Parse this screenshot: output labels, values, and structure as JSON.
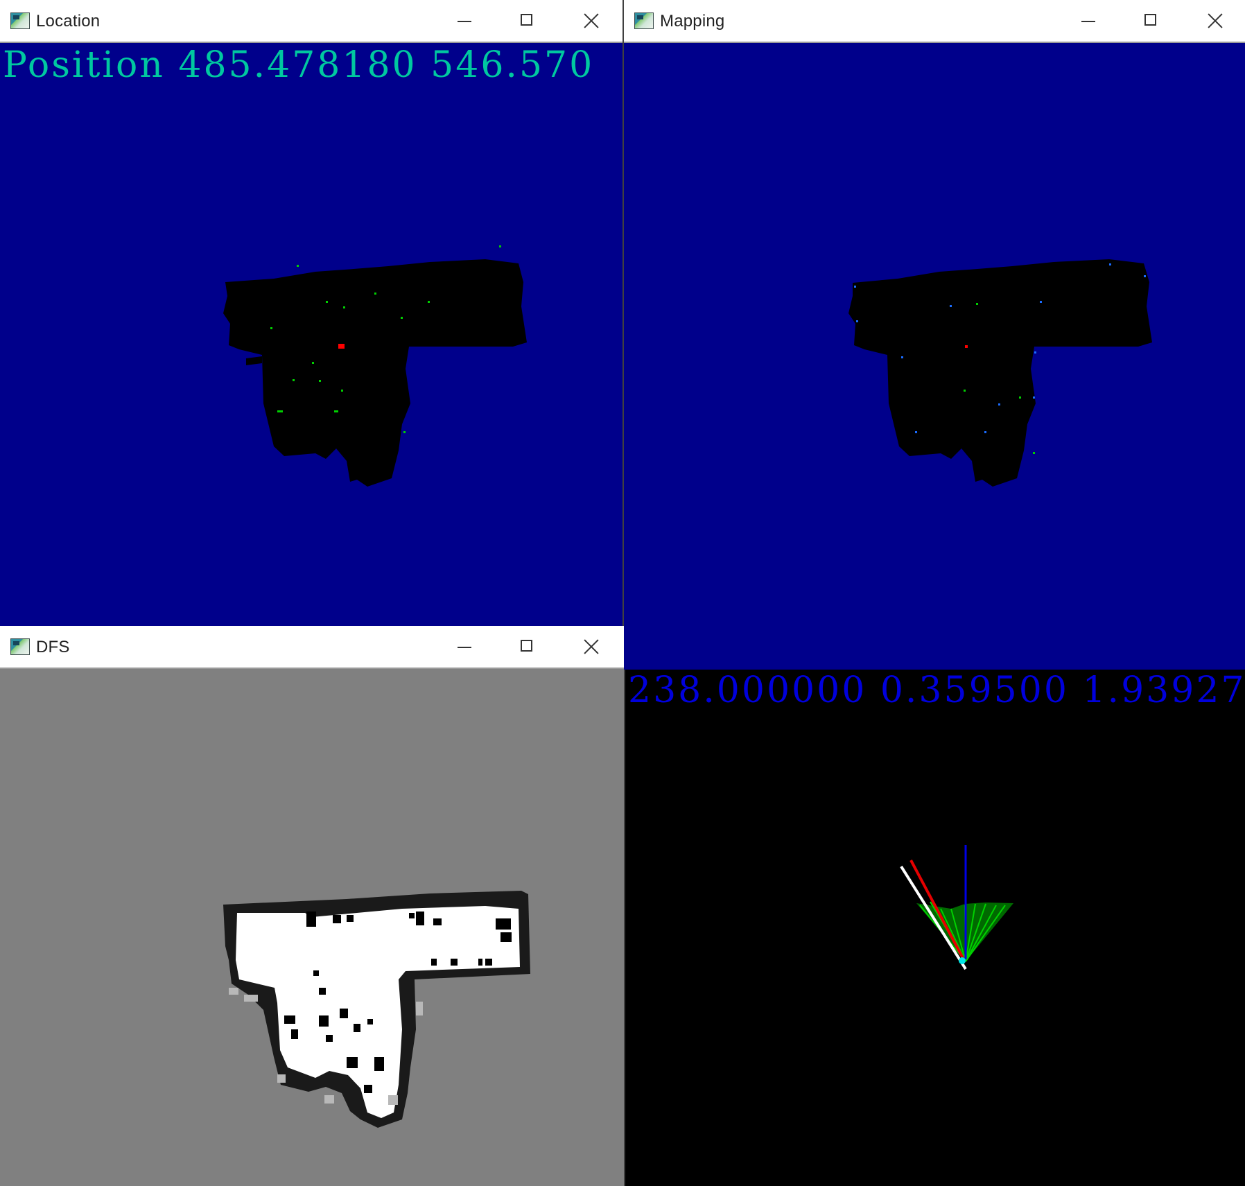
{
  "windows": {
    "location": {
      "title": "Location",
      "overlay_text": "Position 485.478180  546.570",
      "bg_color": "#00008b",
      "text_color": "#00c8a0"
    },
    "mapping": {
      "title": "Mapping",
      "bg_color": "#00008b"
    },
    "dfs": {
      "title": "DFS",
      "bg_color": "#808080"
    },
    "scan": {
      "overlay_text": "238.000000  0.359500  1.93927",
      "bg_color": "#000000",
      "text_color": "#0000dc"
    }
  },
  "colors": {
    "robot_marker": "#ff0000",
    "scan_points": "#00e600",
    "heading_red": "#e60000",
    "heading_white": "#ffffff",
    "heading_blue": "#0000e6",
    "robot_cyan": "#00e6e6"
  }
}
